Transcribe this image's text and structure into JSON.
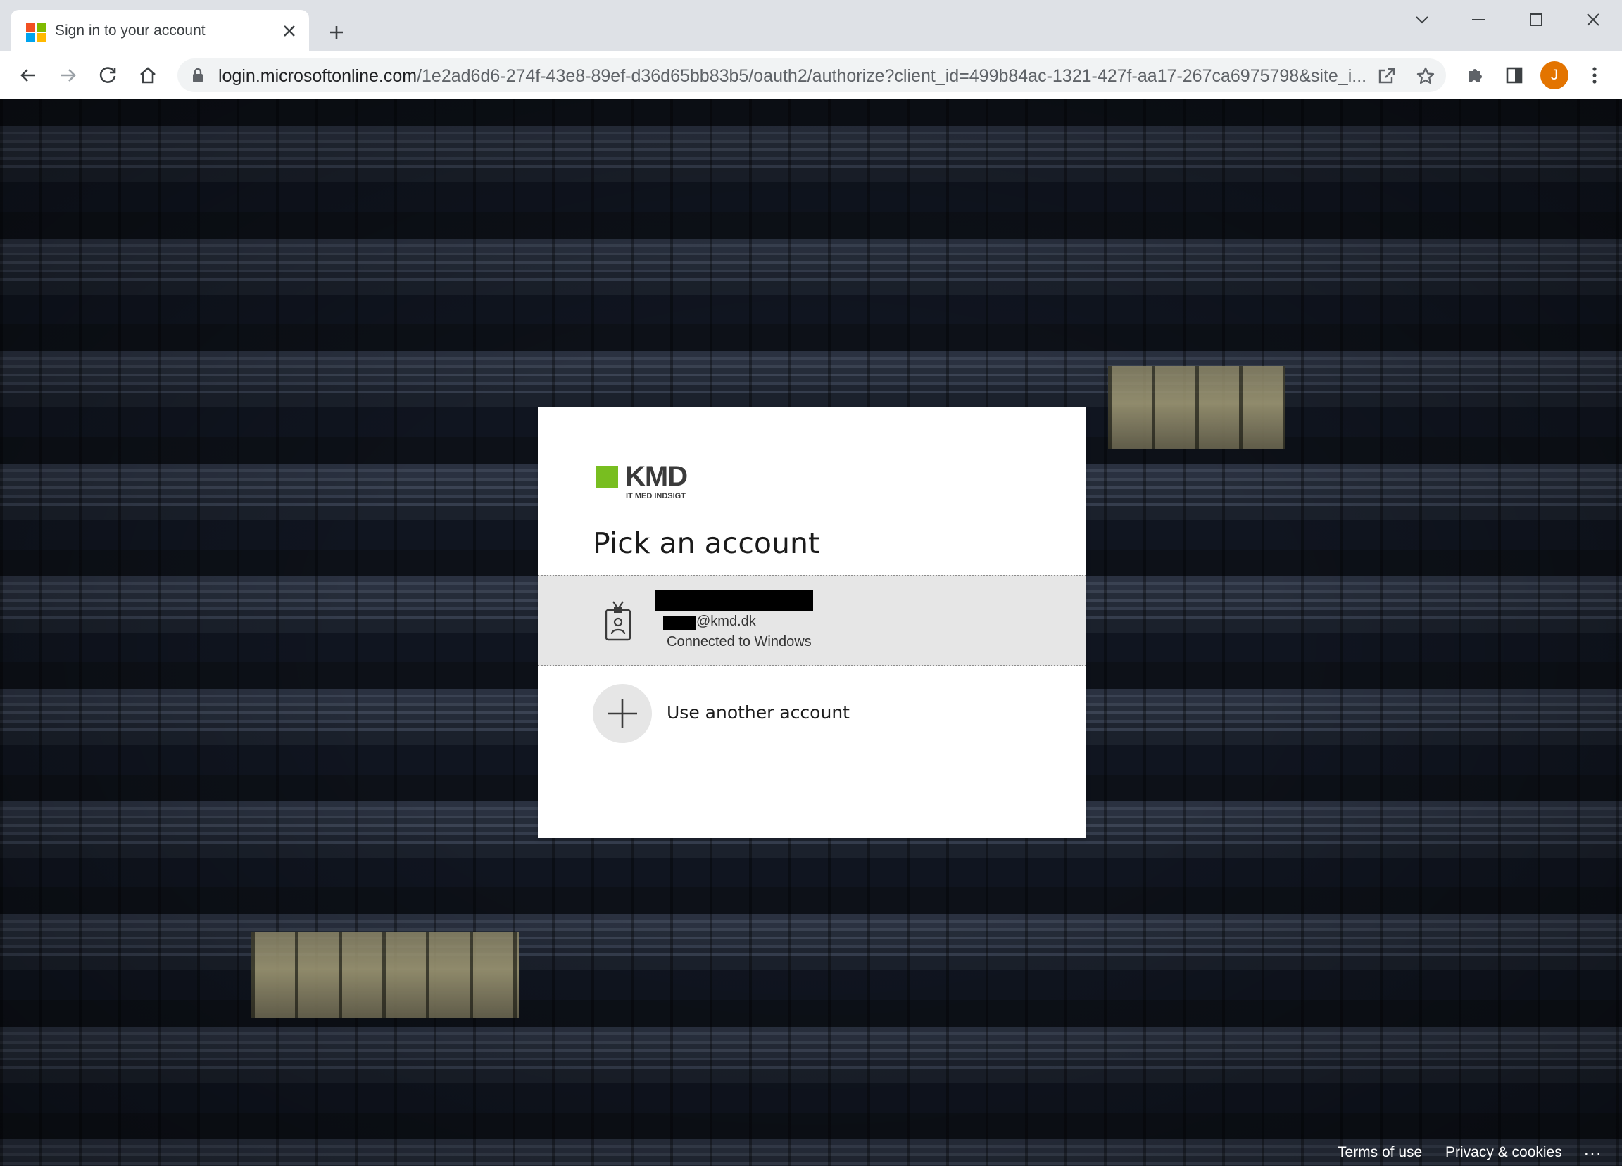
{
  "browser": {
    "tab_title": "Sign in to your account",
    "new_tab_glyph": "+",
    "url_host": "login.microsoftonline.com",
    "url_path": "/1e2ad6d6-274f-43e8-89ef-d36d65bb83b5/oauth2/authorize?client_id=499b84ac-1321-427f-aa17-267ca6975798&site_i...",
    "profile_initial": "J",
    "favicon_colors": [
      "#f25022",
      "#7fba00",
      "#00a4ef",
      "#ffb900"
    ],
    "profile_color": "#e37400"
  },
  "icons": {
    "back": "arrow-left-icon",
    "forward": "arrow-right-icon",
    "reload": "reload-icon",
    "home": "home-icon",
    "lock": "lock-icon",
    "share": "share-icon",
    "star": "star-icon",
    "extensions": "puzzle-icon",
    "side_panel": "side-panel-icon",
    "menu": "kebab-menu-icon",
    "badge": "id-badge-icon",
    "plus": "plus-icon"
  },
  "card": {
    "logo_text": "KMD",
    "logo_tagline": "IT MED INDSIGT",
    "logo_color": "#78be20",
    "title": "Pick an account",
    "account": {
      "email": "@kmd.dk",
      "status": "Connected to Windows"
    },
    "another_account_label": "Use another account"
  },
  "footer": {
    "terms": "Terms of use",
    "privacy": "Privacy & cookies",
    "more": "..."
  }
}
